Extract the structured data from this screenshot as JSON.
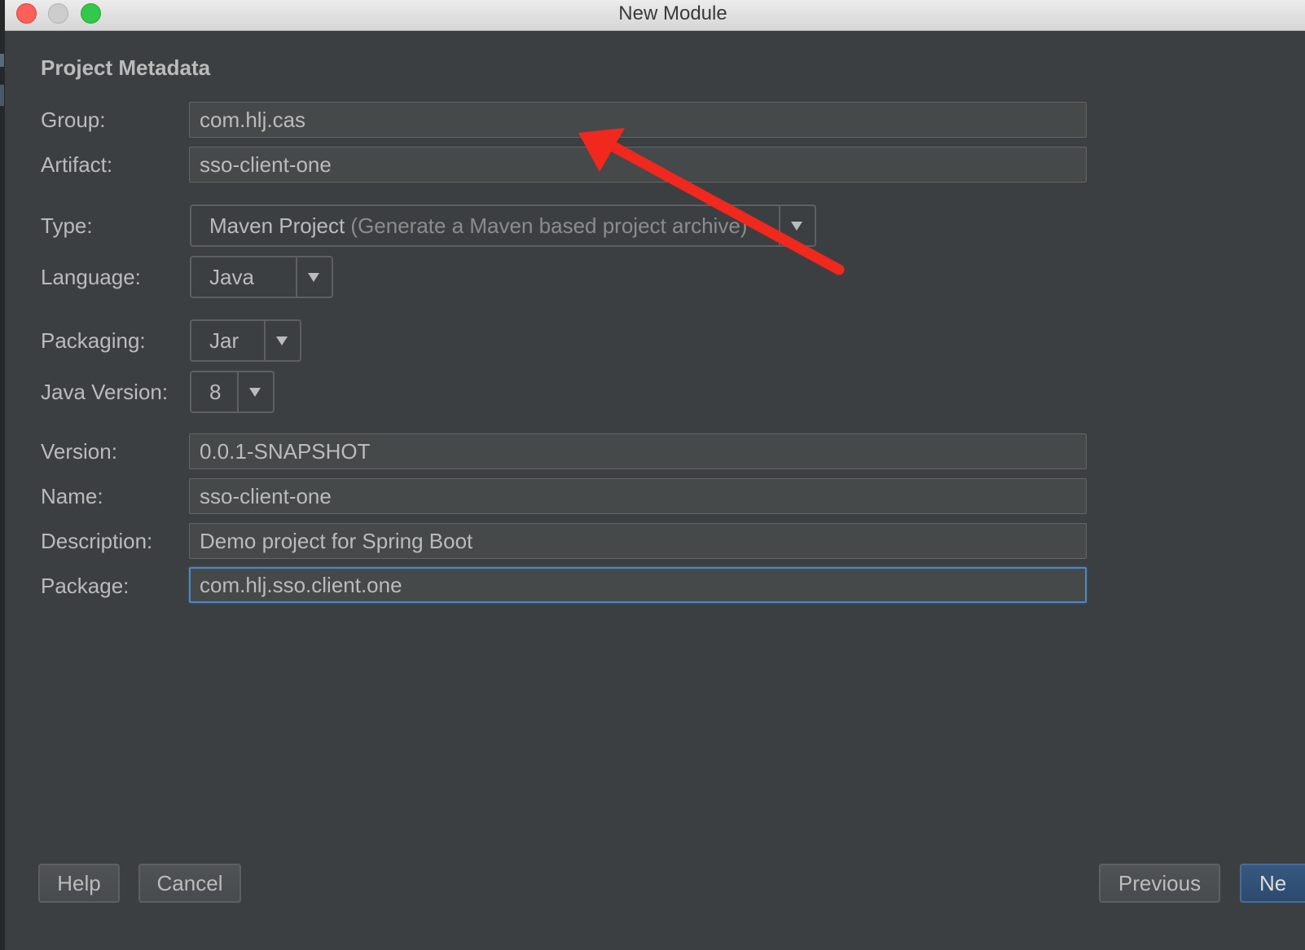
{
  "window": {
    "title": "New Module"
  },
  "section": {
    "title": "Project Metadata"
  },
  "fields": {
    "group": {
      "label": "Group:",
      "value": "com.hlj.cas"
    },
    "artifact": {
      "label": "Artifact:",
      "value": "sso-client-one"
    },
    "type": {
      "label": "Type:",
      "value": "Maven Project",
      "hint": "(Generate a Maven based project archive)"
    },
    "language": {
      "label": "Language:",
      "value": "Java"
    },
    "packaging": {
      "label": "Packaging:",
      "value": "Jar"
    },
    "java_version": {
      "label": "Java Version:",
      "value": "8"
    },
    "version": {
      "label": "Version:",
      "value": "0.0.1-SNAPSHOT"
    },
    "name": {
      "label": "Name:",
      "value": "sso-client-one"
    },
    "description": {
      "label": "Description:",
      "value": "Demo project for Spring Boot"
    },
    "package": {
      "label": "Package:",
      "value": "com.hlj.sso.client.one"
    }
  },
  "buttons": {
    "help": "Help",
    "cancel": "Cancel",
    "previous": "Previous",
    "next": "Ne"
  },
  "annotation": {
    "color": "#f0281e"
  },
  "colors": {
    "accent": "#4a88c7"
  }
}
